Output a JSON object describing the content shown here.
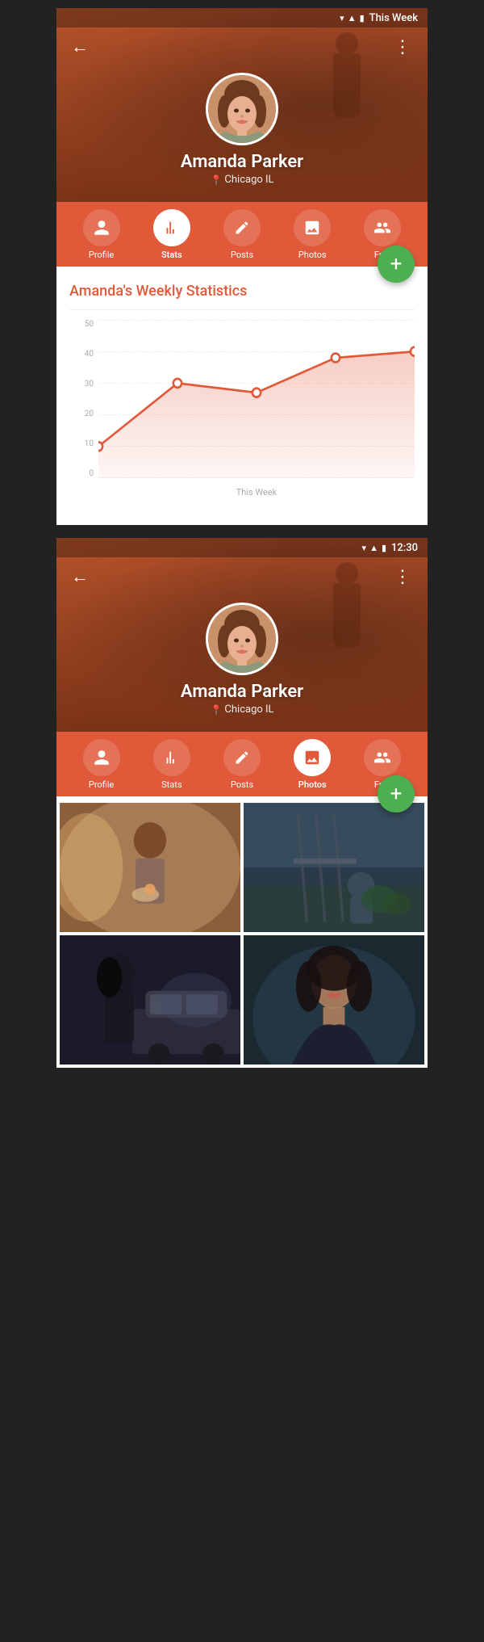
{
  "app": {
    "status_bar": {
      "time": "12:30"
    },
    "screens": [
      {
        "id": "stats-screen",
        "user": {
          "name": "Amanda Parker",
          "location": "Chicago IL"
        },
        "tabs": [
          {
            "id": "profile",
            "label": "Profile",
            "icon": "person",
            "active": false
          },
          {
            "id": "stats",
            "label": "Stats",
            "icon": "bar-chart",
            "active": true
          },
          {
            "id": "posts",
            "label": "Posts",
            "icon": "pencil",
            "active": false
          },
          {
            "id": "photos",
            "label": "Photos",
            "icon": "image",
            "active": false
          },
          {
            "id": "friends",
            "label": "Fri...",
            "icon": "people",
            "active": false
          }
        ],
        "fab": "+",
        "content": {
          "section_title": "Amanda's Weekly Statistics",
          "chart": {
            "x_label": "This Week",
            "y_labels": [
              "0",
              "10",
              "20",
              "30",
              "40",
              "50"
            ],
            "data_points": [
              10,
              30,
              27,
              38,
              40
            ]
          }
        }
      },
      {
        "id": "photos-screen",
        "user": {
          "name": "Amanda Parker",
          "location": "Chicago IL"
        },
        "tabs": [
          {
            "id": "profile",
            "label": "Profile",
            "icon": "person",
            "active": false
          },
          {
            "id": "stats",
            "label": "Stats",
            "icon": "bar-chart",
            "active": false
          },
          {
            "id": "posts",
            "label": "Posts",
            "icon": "pencil",
            "active": false
          },
          {
            "id": "photos",
            "label": "Photos",
            "icon": "image",
            "active": true
          },
          {
            "id": "friends",
            "label": "Fri...",
            "icon": "people",
            "active": false
          }
        ],
        "fab": "+",
        "photos": [
          {
            "id": 1,
            "alt": "Girl with flowers"
          },
          {
            "id": 2,
            "alt": "Girl sitting outdoors"
          },
          {
            "id": 3,
            "alt": "Dark haired woman by car"
          },
          {
            "id": 4,
            "alt": "Woman portrait"
          }
        ]
      }
    ]
  }
}
